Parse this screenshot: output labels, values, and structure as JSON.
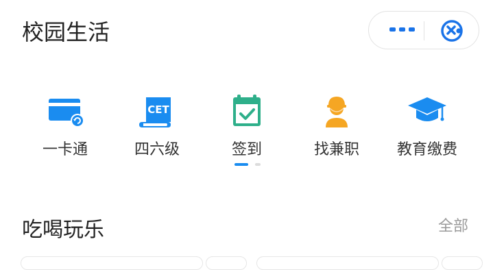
{
  "header": {
    "title": "校园生活"
  },
  "capsule": {
    "more_icon": "more-dots-icon",
    "close_icon": "close-circle-icon",
    "accent": "#1a73e8"
  },
  "services": [
    {
      "label": "一卡通",
      "icon": "card-icon"
    },
    {
      "label": "四六级",
      "icon": "cet-certificate-icon"
    },
    {
      "label": "签到",
      "icon": "calendar-check-icon"
    },
    {
      "label": "找兼职",
      "icon": "worker-icon"
    },
    {
      "label": "教育缴费",
      "icon": "graduation-cap-icon"
    }
  ],
  "pager": {
    "pages": 2,
    "current": 1
  },
  "section": {
    "title": "吃喝玩乐",
    "view_all": "全部"
  },
  "colors": {
    "blue": "#1a8cf0",
    "green": "#2eaf8a",
    "orange": "#f5a623"
  }
}
